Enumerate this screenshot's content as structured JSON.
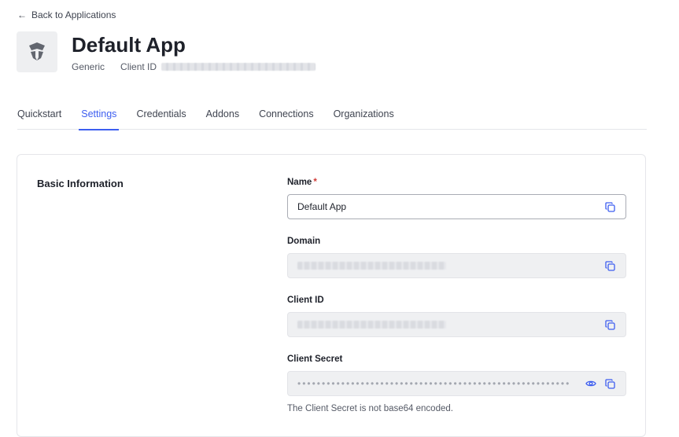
{
  "nav": {
    "back_label": "Back to Applications"
  },
  "app": {
    "title": "Default App",
    "type": "Generic",
    "client_id_label": "Client ID"
  },
  "tabs": [
    {
      "label": "Quickstart",
      "active": false
    },
    {
      "label": "Settings",
      "active": true
    },
    {
      "label": "Credentials",
      "active": false
    },
    {
      "label": "Addons",
      "active": false
    },
    {
      "label": "Connections",
      "active": false
    },
    {
      "label": "Organizations",
      "active": false
    }
  ],
  "basic_info": {
    "section_title": "Basic Information",
    "name_label": "Name",
    "required_mark": "*",
    "name_value": "Default App",
    "domain_label": "Domain",
    "client_id_label": "Client ID",
    "client_secret_label": "Client Secret",
    "client_secret_masked": "••••••••••••••••••••••••••••••••••••••••••••••••••••••••",
    "client_secret_note": "The Client Secret is not base64 encoded."
  },
  "colors": {
    "accent": "#3d5ef0",
    "required": "#d03c38",
    "text": "#1e212a",
    "muted": "#555a66",
    "readonly_bg": "#eff0f2"
  },
  "icons": {
    "back": "arrow-left-icon",
    "logo": "shield-logo-icon",
    "copy": "copy-icon",
    "reveal": "eye-icon"
  }
}
